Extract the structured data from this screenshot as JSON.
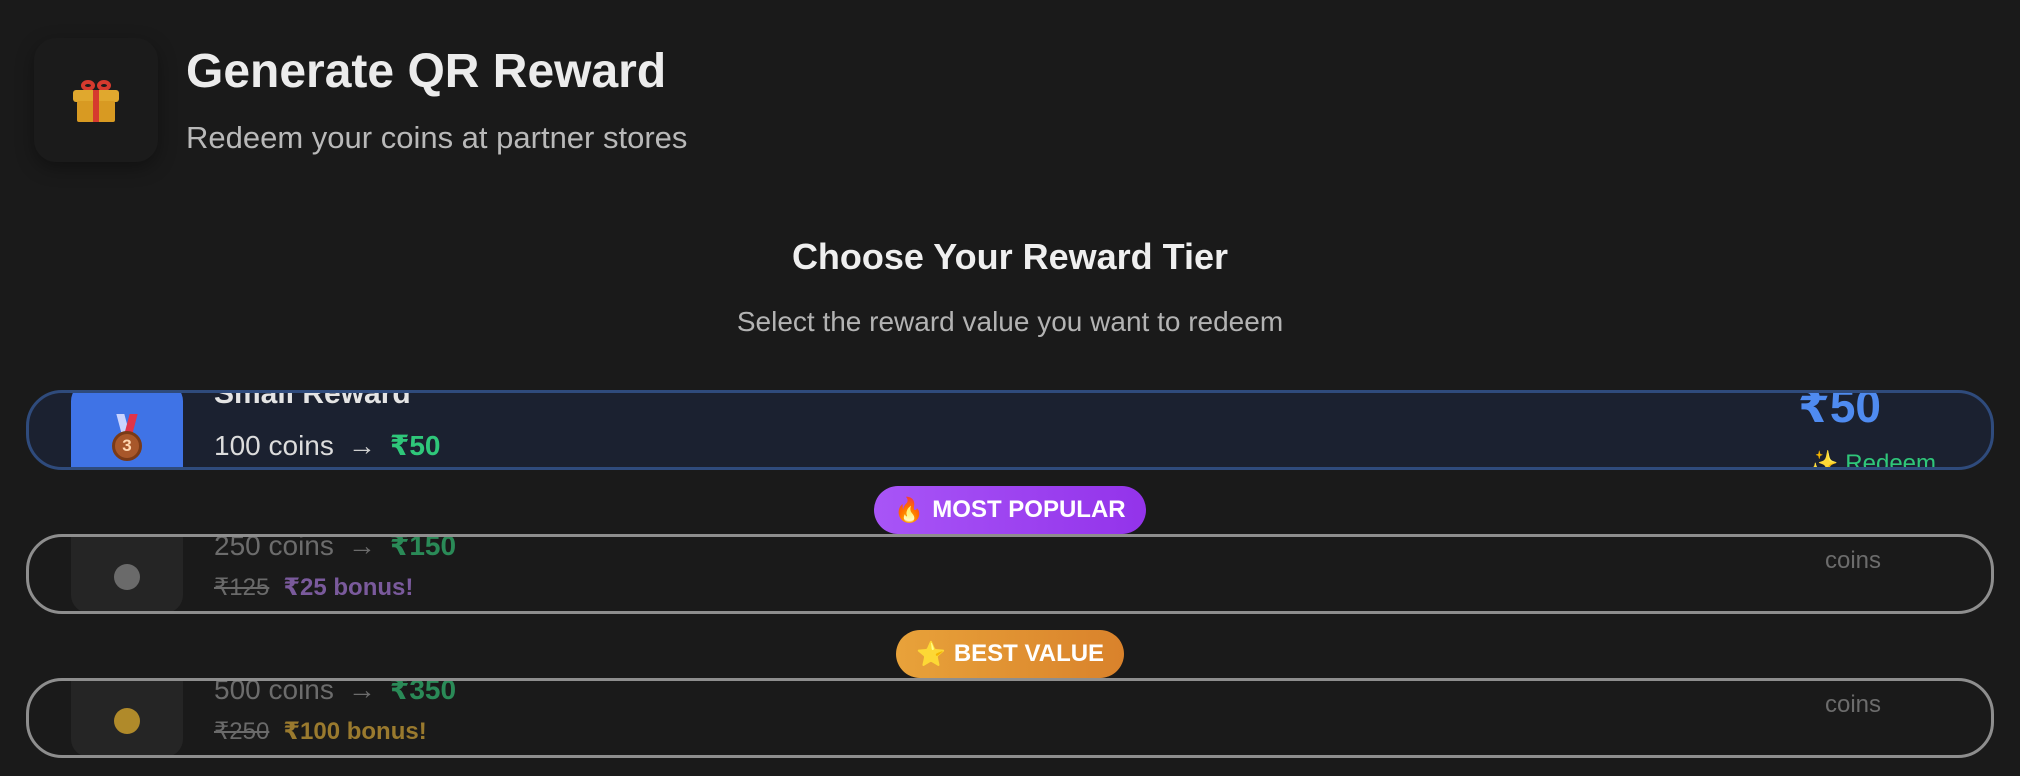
{
  "header": {
    "icon": "gift-icon",
    "title": "Generate QR Reward",
    "subtitle": "Redeem your coins at partner stores"
  },
  "section": {
    "title": "Choose Your Reward Tier",
    "subtitle": "Select the reward value you want to redeem"
  },
  "tiers": [
    {
      "name": "Small Reward",
      "icon": "bronze-medal-icon",
      "medal_number": "3",
      "coins_text": "100 coins",
      "arrow": "→",
      "value_text": "₹50",
      "price_text": "₹50",
      "action_text": "✨ Redeem",
      "selected": true
    },
    {
      "badge": "MOST POPULAR",
      "badge_icon": "fire-icon",
      "badge_glyph": "🔥",
      "icon": "silver-medal-icon",
      "coins_text": "250 coins",
      "arrow": "→",
      "value_text": "₹150",
      "old_value": "₹125",
      "bonus_text": "₹25 bonus!",
      "right_label": "coins",
      "selected": false
    },
    {
      "badge": "BEST VALUE",
      "badge_icon": "star-icon",
      "badge_glyph": "⭐",
      "icon": "gold-medal-icon",
      "coins_text": "500 coins",
      "arrow": "→",
      "value_text": "₹350",
      "old_value": "₹250",
      "bonus_text": "₹100 bonus!",
      "right_label": "coins",
      "selected": false
    }
  ],
  "colors": {
    "background": "#1a1a1a",
    "selected_border": "#2f4b7c",
    "accent_blue": "#4f8bf0",
    "accent_green": "#2fc77a",
    "popular_purple": "#9333ea",
    "best_orange": "#d9822b"
  }
}
